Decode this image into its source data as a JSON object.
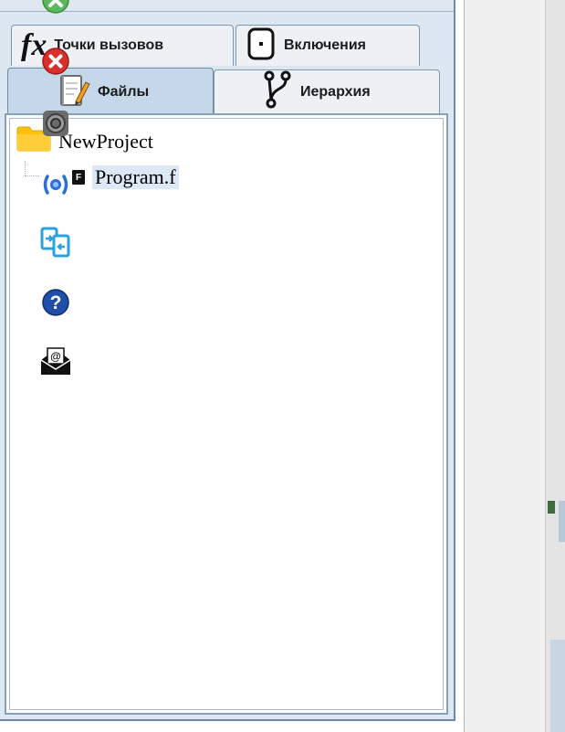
{
  "tabs": {
    "row1": [
      {
        "label": "Точки вызовов",
        "icon": "fx-icon",
        "icon_text": "fx"
      },
      {
        "label": "Включения",
        "icon": "include-file-icon"
      }
    ],
    "row2": [
      {
        "label": "Файлы",
        "icon": "notepad-icon",
        "active": true
      },
      {
        "label": "Иерархия",
        "icon": "branch-icon"
      }
    ]
  },
  "tree": {
    "root": {
      "label": "NewProject",
      "icon": "folder-icon"
    },
    "children": [
      {
        "label": "Program.f",
        "icon": "fortran-file-icon",
        "icon_text": "F",
        "selected": true
      }
    ]
  },
  "toolbar": {
    "buttons": [
      {
        "name": "confirm-icon",
        "color": "#4caf50"
      },
      {
        "name": "close-icon",
        "color": "#d32f2f"
      },
      {
        "name": "settings-icon",
        "color": "#6b6b6b"
      },
      {
        "name": "broadcast-icon",
        "color": "#2b6fd6"
      },
      {
        "name": "transfer-icon",
        "color": "#29a3e0"
      },
      {
        "name": "help-icon",
        "color": "#1f4fa8",
        "icon_text": "?"
      },
      {
        "name": "email-icon",
        "color": "#111111",
        "icon_text": "@"
      }
    ]
  },
  "colors": {
    "accent": "#c5d8ea",
    "selection": "#dce8f6",
    "folder": "#ffc107"
  }
}
